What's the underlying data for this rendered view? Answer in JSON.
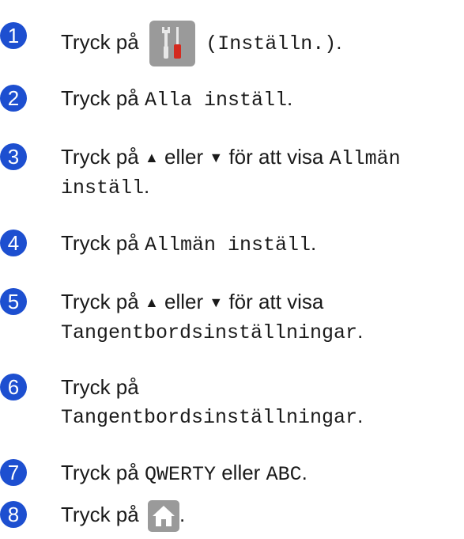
{
  "accent_color": "#1d4fd0",
  "steps": [
    {
      "num": "1",
      "pre": "Tryck på",
      "code": "(Inställn.)",
      "post": "."
    },
    {
      "num": "2",
      "pre": "Tryck på",
      "code": "Alla inställ",
      "post": "."
    },
    {
      "num": "3",
      "pre": "Tryck på",
      "up": "▲",
      "mid": "eller",
      "down": "▼",
      "post_text": "för att visa",
      "code1": "Allmän",
      "code2": "inställ",
      "post": "."
    },
    {
      "num": "4",
      "pre": "Tryck på",
      "code": "Allmän inställ",
      "post": "."
    },
    {
      "num": "5",
      "pre": "Tryck på",
      "up": "▲",
      "mid": "eller",
      "down": "▼",
      "post_text": "för att visa",
      "code": "Tangentbordsinställningar",
      "post": "."
    },
    {
      "num": "6",
      "pre": "Tryck på",
      "code": "Tangentbordsinställningar",
      "post": "."
    },
    {
      "num": "7",
      "pre": "Tryck på",
      "code1": "QWERTY",
      "mid": "eller",
      "code2": "ABC",
      "post": "."
    },
    {
      "num": "8",
      "pre": "Tryck på",
      "post": "."
    }
  ],
  "icons": {
    "settings": "settings-tools-icon",
    "home": "home-icon"
  }
}
